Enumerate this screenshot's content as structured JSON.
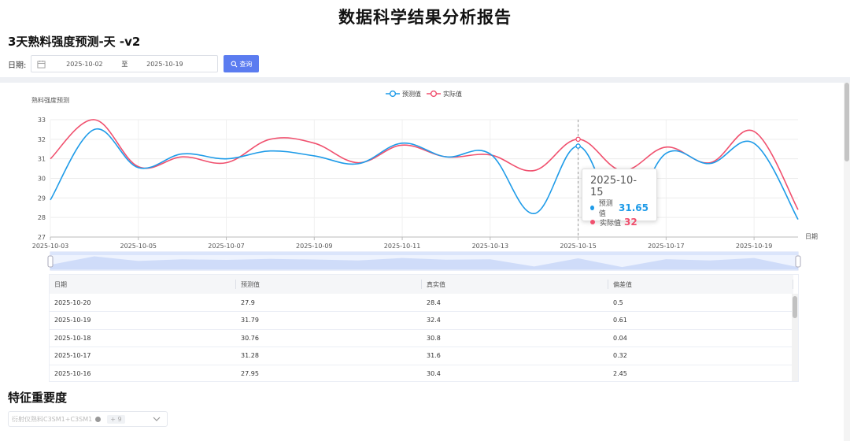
{
  "report_title": "数据科学结果分析报告",
  "section1_title": "3天熟料强度预测-天 -v2",
  "date_filter": {
    "label": "日期:",
    "start": "2025-10-02",
    "separator": "至",
    "end": "2025-10-19",
    "query_label": "查询",
    "query_color": "#5b7cf0"
  },
  "chart_data": {
    "type": "line",
    "ylabel": "熟料强度预测",
    "xlabel": "日期",
    "ylim": [
      27,
      33
    ],
    "yticks": [
      27,
      28,
      29,
      30,
      31,
      32,
      33
    ],
    "x": [
      "2025-10-03",
      "2025-10-04",
      "2025-10-05",
      "2025-10-06",
      "2025-10-07",
      "2025-10-08",
      "2025-10-09",
      "2025-10-10",
      "2025-10-11",
      "2025-10-12",
      "2025-10-13",
      "2025-10-14",
      "2025-10-15",
      "2025-10-16",
      "2025-10-17",
      "2025-10-18",
      "2025-10-19",
      "2025-10-20"
    ],
    "xtick_labels": [
      "2025-10-03",
      "2025-10-05",
      "2025-10-07",
      "2025-10-09",
      "2025-10-11",
      "2025-10-13",
      "2025-10-15",
      "2025-10-17",
      "2025-10-19"
    ],
    "series": [
      {
        "name": "预测值",
        "color": "#1e9be8",
        "values": [
          28.9,
          32.5,
          30.55,
          31.25,
          31.0,
          31.4,
          31.15,
          30.75,
          31.8,
          31.1,
          31.25,
          28.2,
          31.65,
          27.95,
          31.28,
          30.76,
          31.79,
          27.9
        ]
      },
      {
        "name": "实际值",
        "color": "#f0506e",
        "values": [
          31.0,
          33.0,
          30.6,
          31.1,
          30.8,
          32.0,
          31.8,
          30.8,
          31.7,
          31.1,
          31.2,
          30.4,
          32.0,
          30.4,
          31.6,
          30.8,
          32.4,
          28.4
        ]
      }
    ],
    "legend": "top-center",
    "grid": true,
    "tooltip": {
      "date": "2025-10-15",
      "rows": [
        {
          "name": "预测值",
          "value": "31.65",
          "color": "#1e9be8"
        },
        {
          "name": "实际值",
          "value": "32",
          "color": "#f0506e"
        }
      ]
    }
  },
  "table": {
    "columns": [
      "日期",
      "预测值",
      "真实值",
      "偏差值"
    ],
    "rows": [
      [
        "2025-10-20",
        "27.9",
        "28.4",
        "0.5"
      ],
      [
        "2025-10-19",
        "31.79",
        "32.4",
        "0.61"
      ],
      [
        "2025-10-18",
        "30.76",
        "30.8",
        "0.04"
      ],
      [
        "2025-10-17",
        "31.28",
        "31.6",
        "0.32"
      ],
      [
        "2025-10-16",
        "27.95",
        "30.4",
        "2.45"
      ]
    ]
  },
  "section2_title": "特征重要度",
  "feature_select": {
    "selected": "衍射仪熟料C3SM1+C3SM1",
    "more_tag": "+ 9"
  }
}
